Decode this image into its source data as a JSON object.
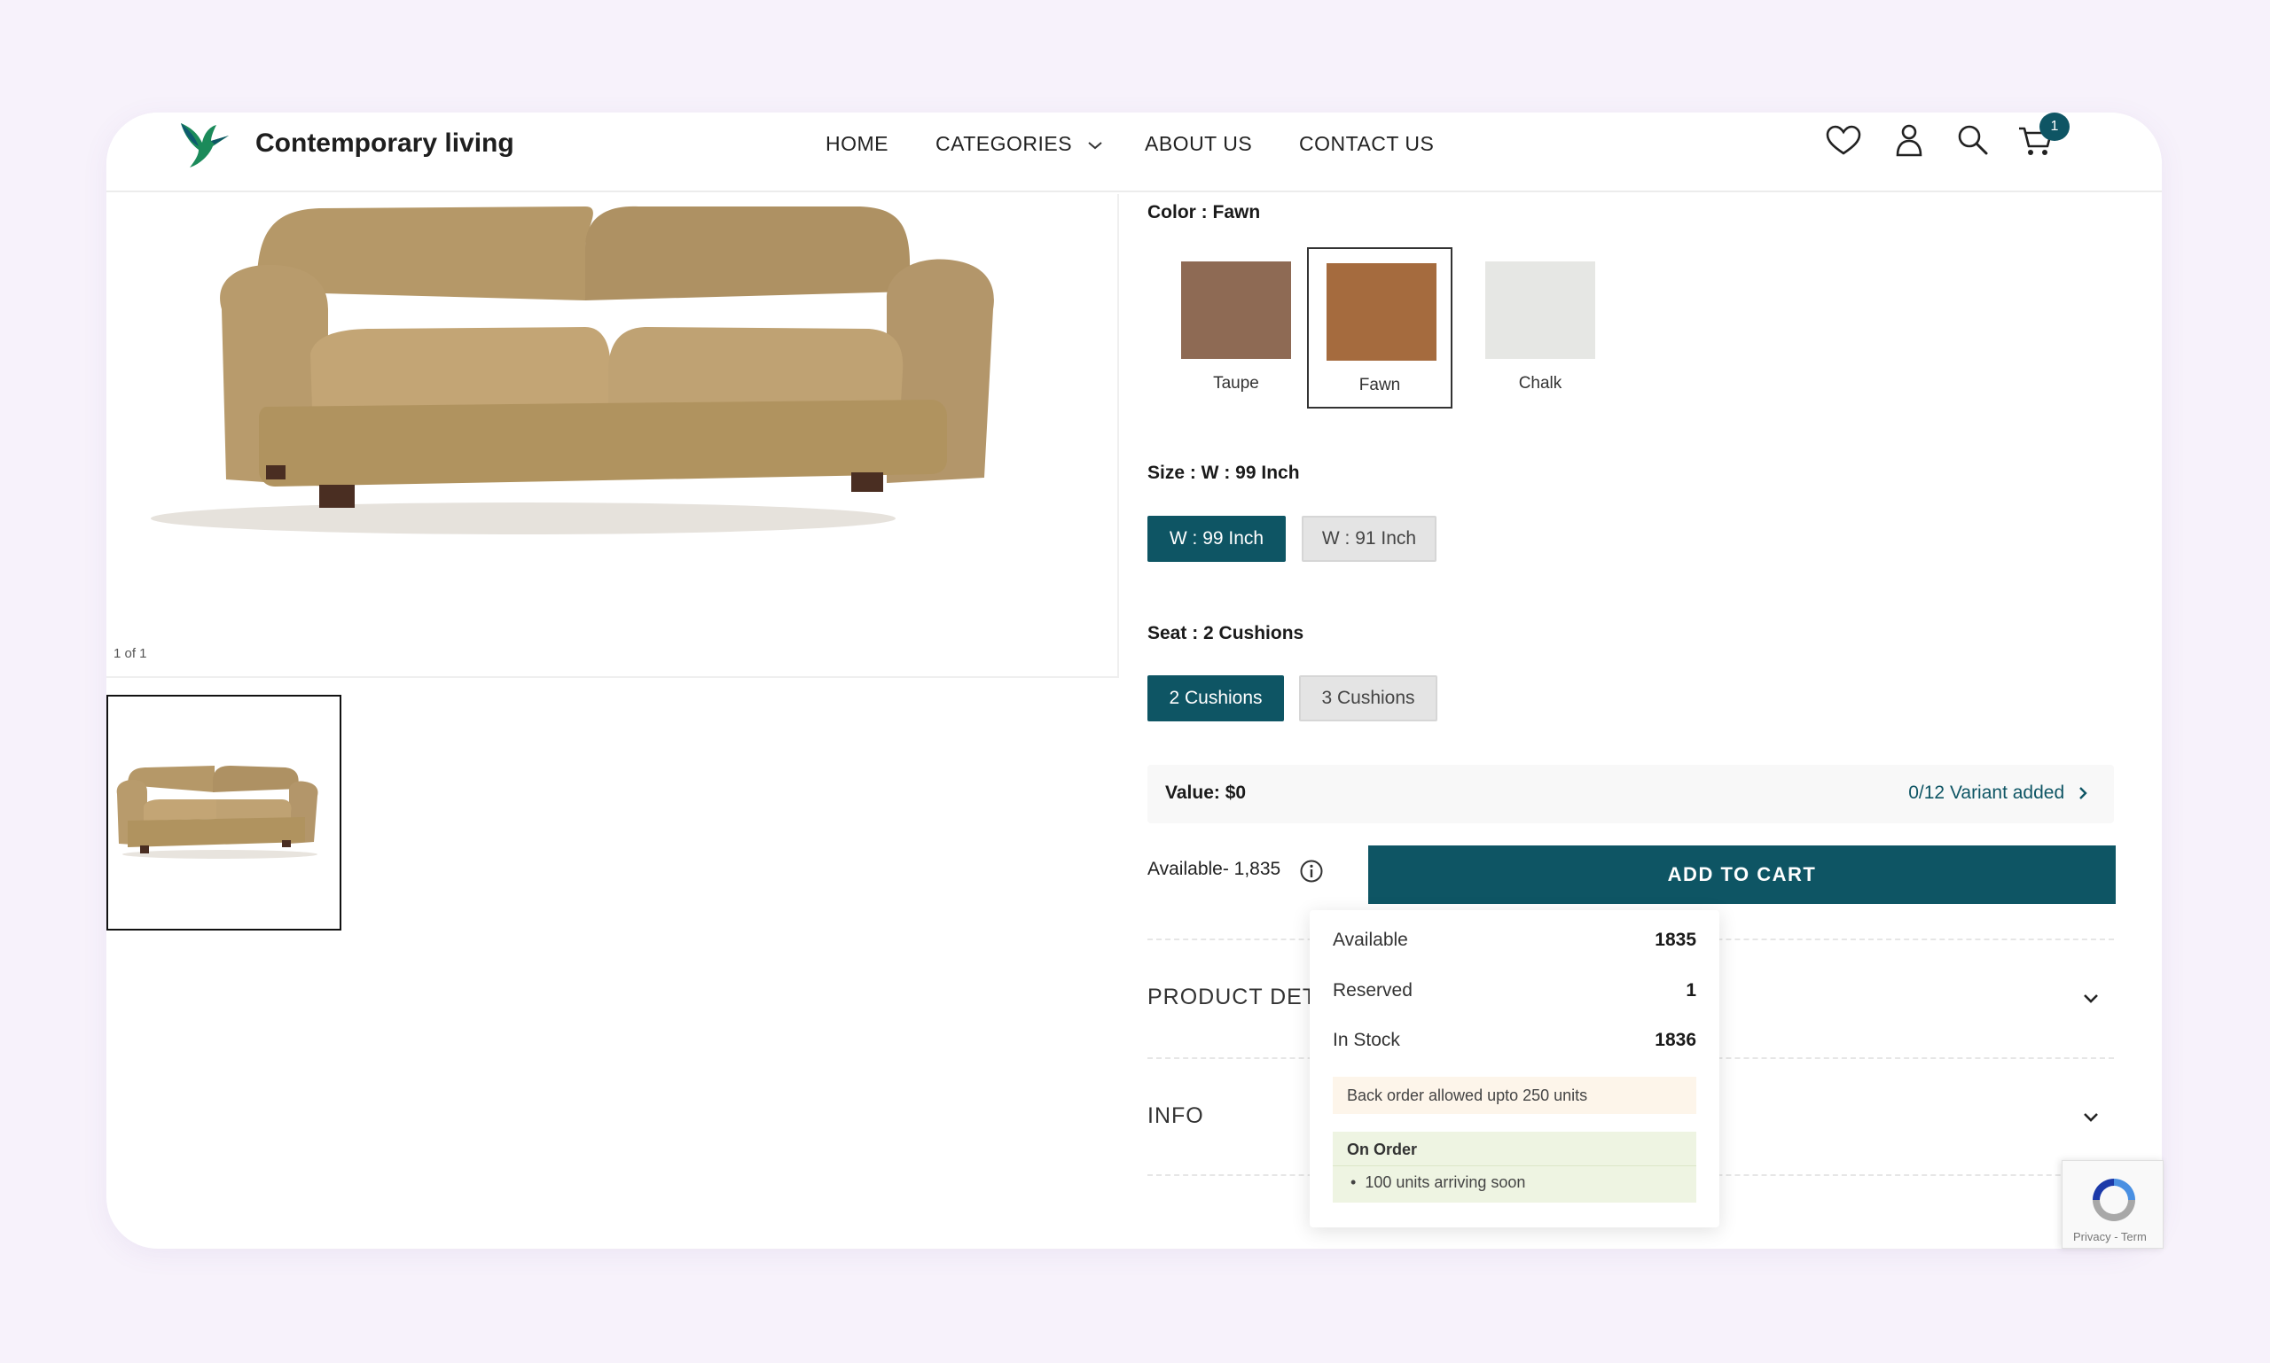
{
  "header": {
    "brand": "Contemporary living",
    "nav": {
      "home": "HOME",
      "categories": "CATEGORIES",
      "about": "ABOUT US",
      "contact": "CONTACT US"
    },
    "cart_count": "1",
    "icons": [
      "heart-icon",
      "user-icon",
      "search-icon",
      "cart-icon"
    ]
  },
  "gallery": {
    "counter": "1 of 1"
  },
  "options": {
    "color_label": "Color : Fawn",
    "colors": [
      {
        "name": "Taupe",
        "hex": "#8e6a54"
      },
      {
        "name": "Fawn",
        "hex": "#a56b3e"
      },
      {
        "name": "Chalk",
        "hex": "#e6e7e4"
      }
    ],
    "selected_color": "Fawn",
    "size_label": "Size : W : 99 Inch",
    "sizes": [
      "W : 99 Inch",
      "W : 91 Inch"
    ],
    "seat_label": "Seat : 2 Cushions",
    "seats": [
      "2 Cushions",
      "3 Cushions"
    ]
  },
  "value": {
    "label": "Value: $0",
    "variant_link": "0/12 Variant added"
  },
  "stock": {
    "available_text": "Available- 1,835",
    "add_to_cart": "ADD TO CART"
  },
  "popover": {
    "available_label": "Available",
    "available_value": "1835",
    "reserved_label": "Reserved",
    "reserved_value": "1",
    "instock_label": "In Stock",
    "instock_value": "1836",
    "backorder": "Back order allowed upto 250 units",
    "on_order_title": "On Order",
    "on_order_item": "100 units arriving soon"
  },
  "accordions": {
    "product_details": "PRODUCT DET",
    "info": "INFO"
  },
  "recaptcha": {
    "text": "Privacy - Term"
  },
  "colors": {
    "accent": "#0e5564",
    "page_bg": "#f7f2fb"
  }
}
